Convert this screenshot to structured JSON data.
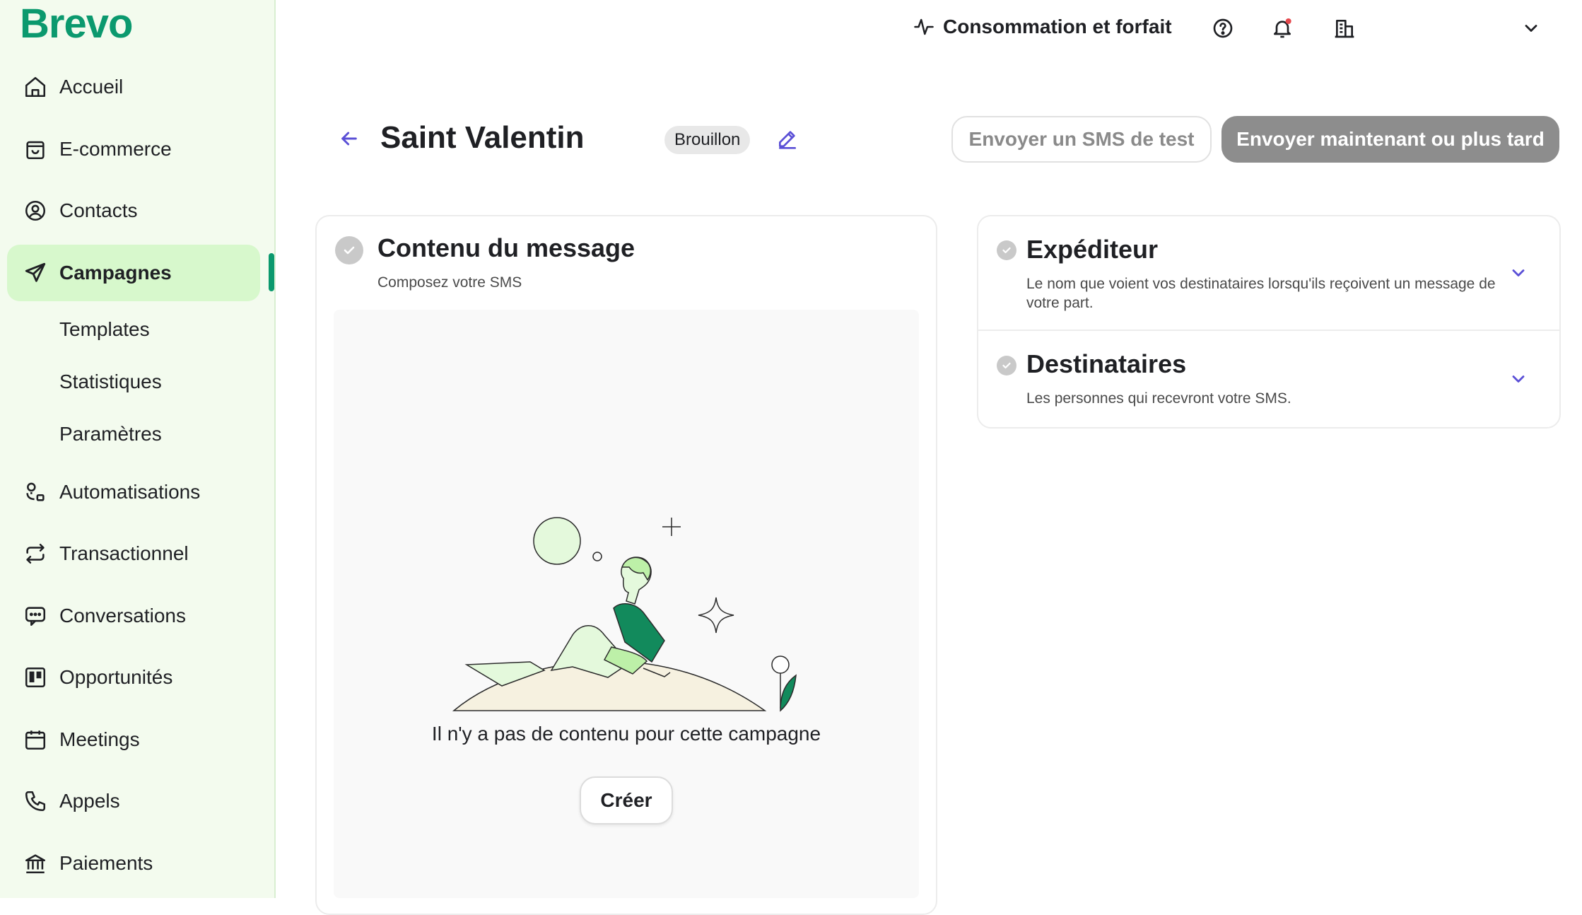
{
  "brand": {
    "logo": "Brevo",
    "accent": "#0b996e",
    "active_bg": "#d7f8cc"
  },
  "sidebar": {
    "items": [
      {
        "label": "Accueil",
        "icon": "home-icon"
      },
      {
        "label": "E-commerce",
        "icon": "shopping-bag-icon"
      },
      {
        "label": "Contacts",
        "icon": "user-circle-icon"
      },
      {
        "label": "Campagnes",
        "icon": "paper-plane-icon",
        "active": true
      },
      {
        "label": "Automatisations",
        "icon": "automation-icon"
      },
      {
        "label": "Transactionnel",
        "icon": "arrows-swap-icon"
      },
      {
        "label": "Conversations",
        "icon": "chat-icon"
      },
      {
        "label": "Opportunités",
        "icon": "kanban-icon"
      },
      {
        "label": "Meetings",
        "icon": "calendar-icon"
      },
      {
        "label": "Appels",
        "icon": "phone-icon"
      },
      {
        "label": "Paiements",
        "icon": "bank-icon"
      }
    ],
    "sub_items": [
      {
        "label": "Templates"
      },
      {
        "label": "Statistiques"
      },
      {
        "label": "Paramètres"
      }
    ]
  },
  "topbar": {
    "usage_label": "Consommation et forfait",
    "icons": [
      "help-icon",
      "bell-icon",
      "building-icon",
      "chevron-down-icon"
    ]
  },
  "header": {
    "title": "Saint Valentin",
    "status_badge": "Brouillon",
    "test_button": "Envoyer un SMS de test",
    "send_button": "Envoyer maintenant ou plus tard"
  },
  "message_card": {
    "title": "Contenu du message",
    "subtitle": "Composez votre SMS",
    "empty_text": "Il n'y a pas de contenu pour cette campagne",
    "create_button": "Créer"
  },
  "settings_card": {
    "sender": {
      "title": "Expéditeur",
      "description": "Le nom que voient vos destinataires lorsqu'ils reçoivent un message de votre part."
    },
    "recipients": {
      "title": "Destinataires",
      "description": "Les personnes qui recevront votre SMS."
    }
  }
}
